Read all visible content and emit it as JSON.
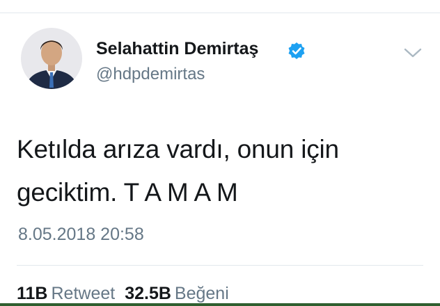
{
  "tweet": {
    "author": {
      "display_name": "Selahattin Demirtaş",
      "handle": "@hdpdemirtas",
      "verified": true,
      "verified_color": "#1da1f2"
    },
    "text_line1": "Ketılda arıza vardı, onun için",
    "text_line2": "geciktim. T A M A M",
    "timestamp": "8.05.2018 20:58",
    "stats": {
      "retweets_count": "11B",
      "retweets_label": "Retweet",
      "likes_count": "32.5B",
      "likes_label": "Beğeni"
    }
  },
  "icons": {
    "verified": "verified-badge-icon",
    "menu": "chevron-down-icon"
  }
}
